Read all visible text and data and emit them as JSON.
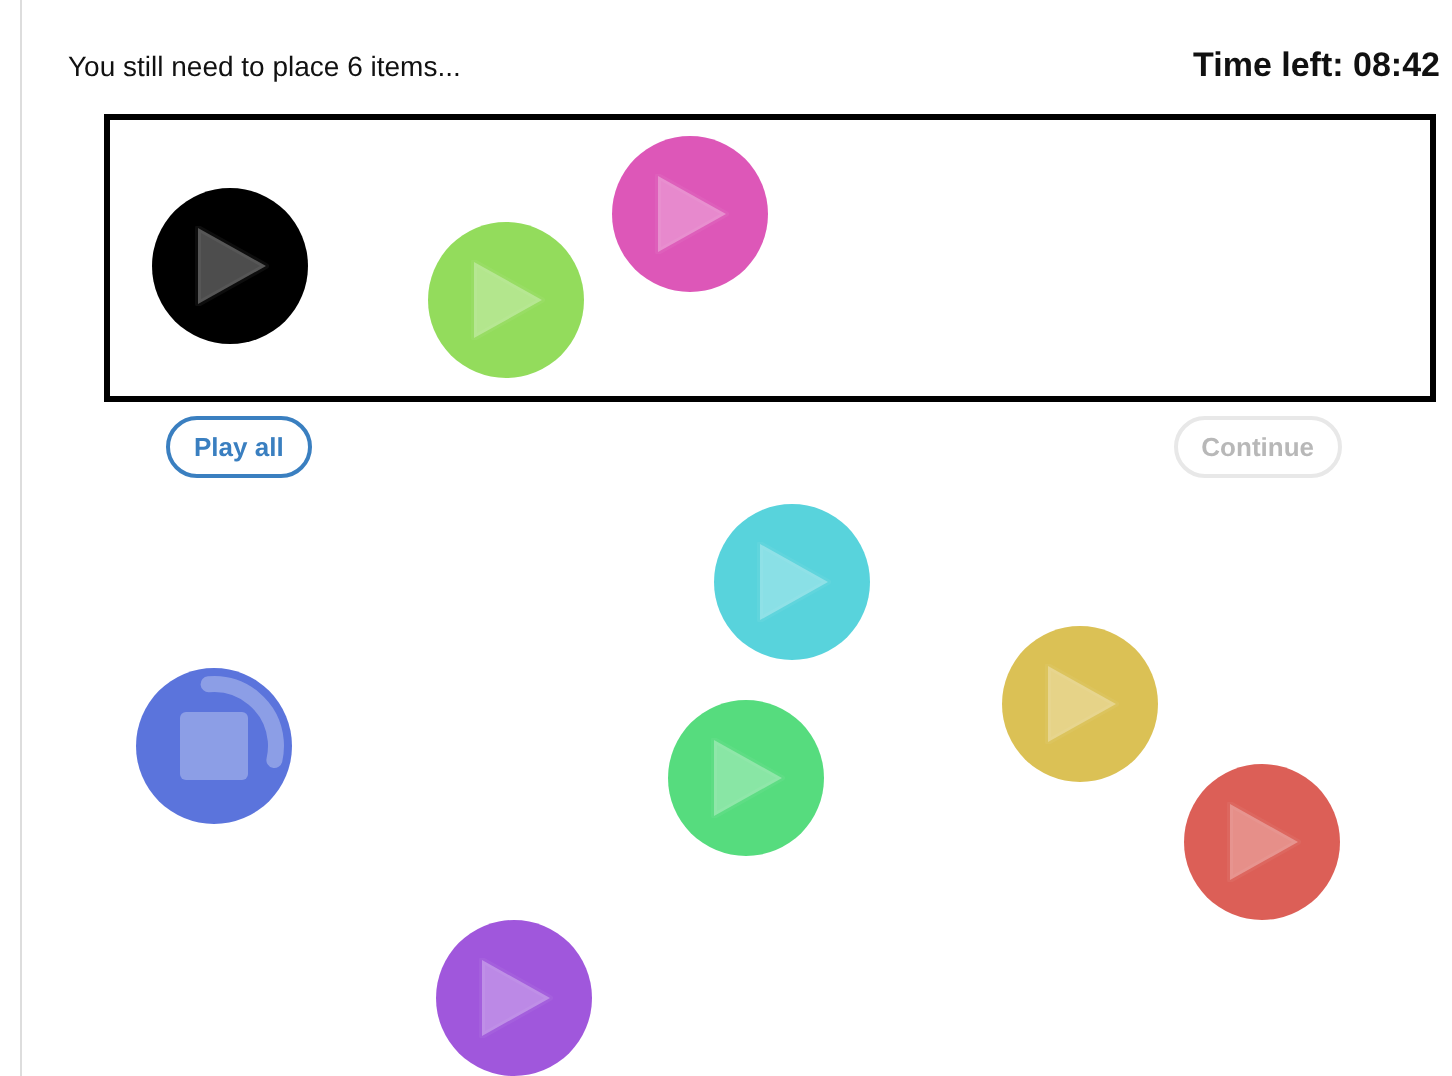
{
  "status": "You still need to place 6 items...",
  "timer": "Time left: 08:42",
  "placed": [
    {
      "color": "#000000",
      "playing": false
    },
    {
      "color": "#93dc5c",
      "playing": false
    },
    {
      "color": "#dd57b8",
      "playing": false
    }
  ],
  "buttons": [
    {
      "label": "Play all",
      "disabled": false
    },
    {
      "label": "Continue",
      "disabled": true
    }
  ],
  "unplaced": [
    {
      "color": "#58d3dc",
      "playing": false
    },
    {
      "color": "#dbc155",
      "playing": false
    },
    {
      "color": "#5b74dc",
      "playing": true,
      "level": 0.3
    },
    {
      "color": "#56dc7e",
      "playing": false
    },
    {
      "color": "#dc5f57",
      "playing": false
    },
    {
      "color": "#a057dc",
      "playing": false
    }
  ]
}
